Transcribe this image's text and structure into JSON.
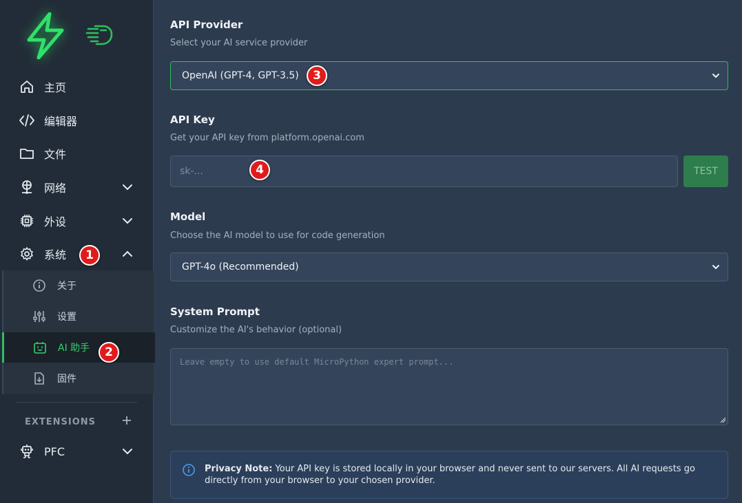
{
  "sidebar": {
    "items": [
      {
        "label": "主页",
        "icon": "home-icon"
      },
      {
        "label": "编辑器",
        "icon": "code-icon"
      },
      {
        "label": "文件",
        "icon": "folder-icon"
      },
      {
        "label": "网络",
        "icon": "network-icon"
      },
      {
        "label": "外设",
        "icon": "chip-icon"
      },
      {
        "label": "系统",
        "icon": "gear-icon"
      }
    ],
    "subitems": [
      {
        "label": "关于",
        "icon": "info-icon"
      },
      {
        "label": "设置",
        "icon": "sliders-icon"
      },
      {
        "label": "AI 助手",
        "icon": "bot-icon",
        "active": true
      },
      {
        "label": "固件",
        "icon": "download-file-icon"
      }
    ],
    "extensions_label": "EXTENSIONS",
    "extension_items": [
      {
        "label": "PFC",
        "icon": "robot-icon"
      }
    ]
  },
  "annotations": [
    "1",
    "2",
    "3",
    "4"
  ],
  "provider": {
    "title": "API Provider",
    "desc": "Select your AI service provider",
    "selected": "OpenAI (GPT-4, GPT-3.5)"
  },
  "apikey": {
    "title": "API Key",
    "desc": "Get your API key from platform.openai.com",
    "placeholder": "sk-...",
    "test_label": "TEST"
  },
  "model": {
    "title": "Model",
    "desc": "Choose the AI model to use for code generation",
    "selected": "GPT-4o (Recommended)"
  },
  "prompt": {
    "title": "System Prompt",
    "desc": "Customize the AI's behavior (optional)",
    "placeholder": "Leave empty to use default MicroPython expert prompt..."
  },
  "privacy": {
    "label": "Privacy Note:",
    "text": " Your API key is stored locally in your browser and never sent to our servers. All AI requests go directly from your browser to your chosen provider."
  },
  "colors": {
    "accent": "#2fbf5f",
    "badge": "#e11b1b",
    "sidebar_bg": "#222c38",
    "main_bg": "#2d3b4e"
  }
}
